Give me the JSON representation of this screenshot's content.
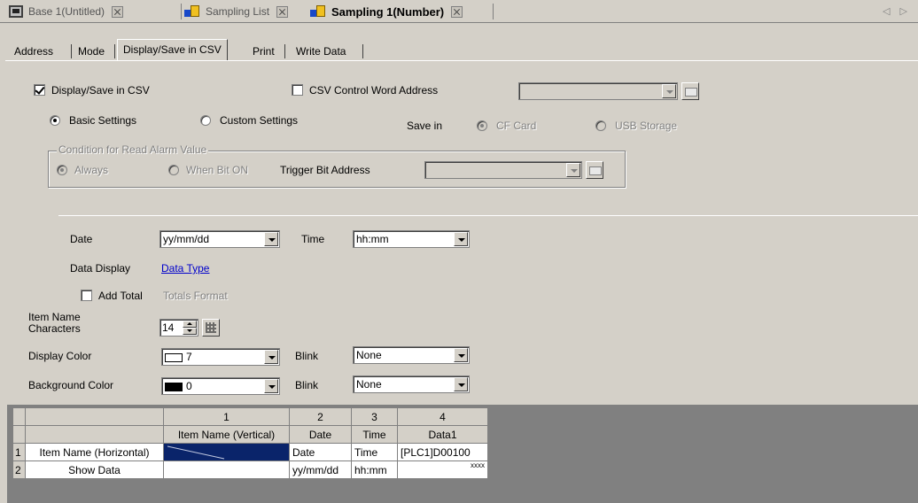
{
  "doc_tabs": [
    {
      "label": "Base 1(Untitled)",
      "icon": "base-screen-icon",
      "active": false
    },
    {
      "label": "Sampling List",
      "icon": "sampling-icon",
      "active": false
    },
    {
      "label": "Sampling 1(Number)",
      "icon": "sampling-icon",
      "active": true
    }
  ],
  "nav_arrows": "◁ ▷",
  "prop_tabs": [
    "Address",
    "Mode",
    "Display/Save in CSV",
    "Print",
    "Write Data"
  ],
  "active_prop_tab": "Display/Save in CSV",
  "csv": {
    "display_save_label": "Display/Save in CSV",
    "display_save_checked": true,
    "control_word_label": "CSV Control Word Address",
    "control_word_checked": false,
    "control_word_value": "",
    "basic_label": "Basic Settings",
    "custom_label": "Custom Settings",
    "mode": "basic",
    "save_in_label": "Save in",
    "cf_card_label": "CF Card",
    "usb_label": "USB Storage"
  },
  "condition": {
    "legend": "Condition for Read Alarm Value",
    "always_label": "Always",
    "when_bit_on_label": "When Bit ON",
    "trigger_label": "Trigger Bit Address",
    "trigger_value": ""
  },
  "format": {
    "date_label": "Date",
    "date_value": "yy/mm/dd",
    "time_label": "Time",
    "time_value": "hh:mm",
    "data_display_label": "Data Display",
    "data_type_link": "Data Type",
    "add_total_label": "Add Total",
    "add_total_checked": false,
    "totals_format_label": "Totals Format",
    "item_name_chars_label_1": "Item Name",
    "item_name_chars_label_2": "Characters",
    "item_name_chars_value": "14",
    "display_color_label": "Display Color",
    "display_color_value": "7",
    "display_color_swatch": "#ffffff",
    "blink_label": "Blink",
    "display_blink_value": "None",
    "background_color_label": "Background Color",
    "background_color_value": "0",
    "background_color_swatch": "#000000",
    "background_blink_value": "None"
  },
  "grid": {
    "col_numbers": [
      "1",
      "2",
      "3",
      "4"
    ],
    "col_headers": [
      "Item Name (Vertical)",
      "Date",
      "Time",
      "Data1"
    ],
    "rows": [
      {
        "num": "1",
        "name": "Item Name (Horizontal)",
        "cells": [
          "",
          "Date",
          "Time",
          "[PLC1]D00100"
        ]
      },
      {
        "num": "2",
        "name": "Show Data",
        "cells": [
          "",
          "yy/mm/dd",
          "hh:mm",
          "xxxx"
        ]
      }
    ]
  }
}
